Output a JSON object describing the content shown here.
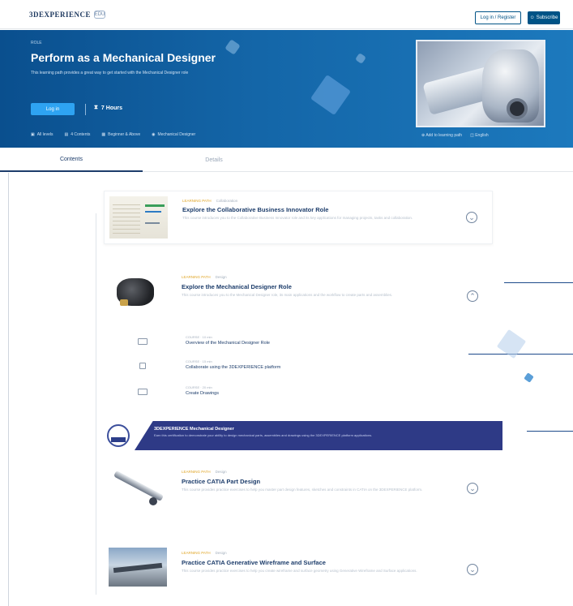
{
  "header": {
    "brand": "3DEXPERIENCE",
    "badge": "EDU",
    "login_label": "Log in / Register",
    "register_label": "Subscribe"
  },
  "hero": {
    "eyebrow": "ROLE",
    "title": "Perform as a Mechanical Designer",
    "description": "This learning path provides a great way to get started with the Mechanical Designer role",
    "login_label": "Log in",
    "hours": "7 Hours",
    "meta": [
      "All levels",
      "4 Contents",
      "Beginner & Above",
      "Mechanical Designer"
    ],
    "actions": [
      "Add to learning path",
      "English"
    ]
  },
  "tabs": {
    "contents": "Contents",
    "details": "Details"
  },
  "courses": [
    {
      "tag": "LEARNING PATH",
      "sub": "Collaboration",
      "title": "Explore the Collaborative Business Innovator Role",
      "description": "This course introduces you to the Collaborative Business Innovator role and its key applications for managing projects, tasks and collaboration."
    },
    {
      "tag": "LEARNING PATH",
      "sub": "Design",
      "title": "Explore the Mechanical Designer Role",
      "description": "This course introduces you to the Mechanical Designer role, its main applications and the workflow to create parts and assemblies."
    }
  ],
  "sub_items": [
    {
      "meta": "COURSE · 10 min",
      "title": "Overview of the Mechanical Designer Role"
    },
    {
      "meta": "COURSE · 15 min",
      "title": "Collaborate using the 3DEXPERIENCE platform"
    },
    {
      "meta": "COURSE · 20 min",
      "title": "Create Drawings"
    }
  ],
  "certification": {
    "title": "3DEXPERIENCE Mechanical Designer",
    "description": "Earn this certification to demonstrate your ability to design mechanical parts, assemblies and drawings using the 3DEXPERIENCE platform applications."
  },
  "practice": [
    {
      "tag": "LEARNING PATH",
      "sub": "Design",
      "title": "Practice CATIA Part Design",
      "description": "This course provides practice exercises to help you master part design features, sketches and constraints in CATIA on the 3DEXPERIENCE platform."
    },
    {
      "tag": "LEARNING PATH",
      "sub": "Design",
      "title": "Practice CATIA Generative Wireframe and Surface",
      "description": "This course provides practice exercises to help you create wireframe and surface geometry using Generative Wireframe and Surface applications."
    }
  ],
  "colors": {
    "hero_blue": "#0a4f8e",
    "accent": "#2ea3f2",
    "navy": "#1d3d6b",
    "tag_gold": "#e0a526",
    "cert_banner": "#2e3a86"
  }
}
